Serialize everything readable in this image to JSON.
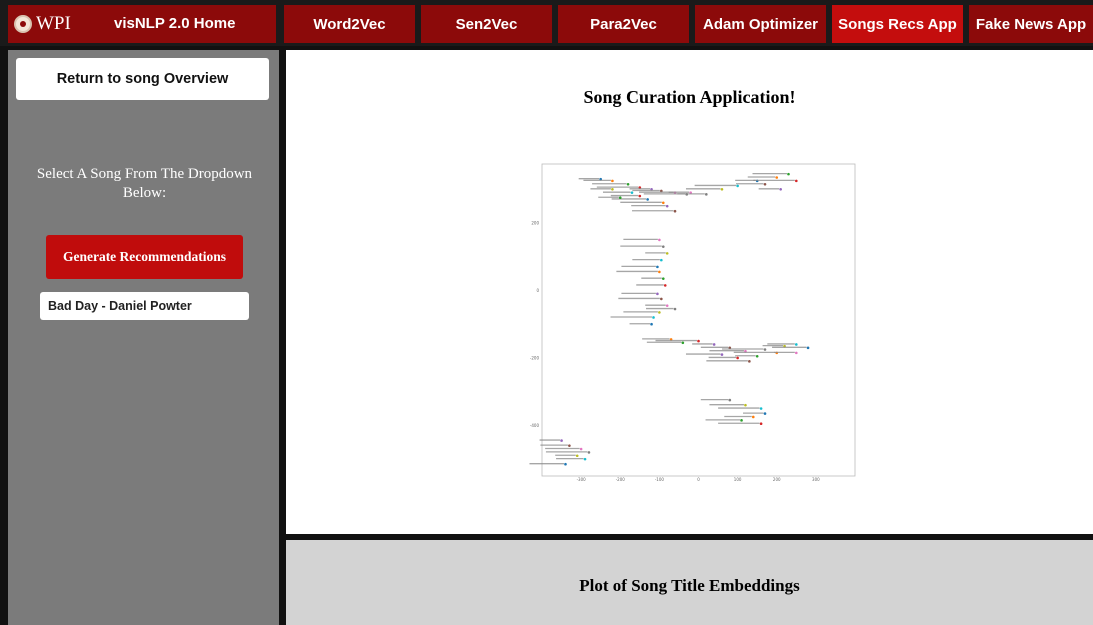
{
  "nav": {
    "logo_text": "WPI",
    "home_label": "visNLP 2.0 Home",
    "tabs": [
      {
        "label": "Word2Vec"
      },
      {
        "label": "Sen2Vec"
      },
      {
        "label": "Para2Vec"
      },
      {
        "label": "Adam Optimizer"
      },
      {
        "label": "Songs Recs App",
        "active": true
      },
      {
        "label": "Fake News App"
      }
    ],
    "colors": {
      "tab": "#8c0a0a",
      "active_tab": "#c40d0d"
    }
  },
  "sidebar": {
    "return_label": "Return to song Overview",
    "select_prompt": "Select A Song From The Dropdown Below:",
    "generate_label": "Generate Recommendations",
    "selected_song": "Bad Day - Daniel Powter"
  },
  "main": {
    "title": "Song Curation Application!"
  },
  "lower": {
    "title": "Plot of Song Title Embeddings"
  },
  "chart_data": {
    "type": "scatter",
    "title": "",
    "xlabel": "",
    "ylabel": "",
    "xlim": [
      -400,
      400
    ],
    "ylim": [
      -550,
      375
    ],
    "x_ticks": [
      -300,
      -200,
      -100,
      0,
      100,
      200,
      300
    ],
    "y_ticks": [
      -400,
      -200,
      0,
      200
    ],
    "grid": false,
    "point_labels_legible": false,
    "points": [
      {
        "x": -250,
        "y": 330
      },
      {
        "x": -220,
        "y": 325
      },
      {
        "x": -180,
        "y": 315
      },
      {
        "x": -150,
        "y": 305
      },
      {
        "x": -120,
        "y": 300
      },
      {
        "x": -95,
        "y": 295
      },
      {
        "x": -60,
        "y": 290
      },
      {
        "x": -30,
        "y": 285
      },
      {
        "x": -220,
        "y": 300
      },
      {
        "x": -170,
        "y": 290
      },
      {
        "x": -130,
        "y": 270
      },
      {
        "x": -90,
        "y": 260
      },
      {
        "x": -200,
        "y": 275
      },
      {
        "x": -150,
        "y": 280
      },
      {
        "x": -80,
        "y": 250
      },
      {
        "x": -60,
        "y": 235
      },
      {
        "x": -20,
        "y": 290
      },
      {
        "x": 20,
        "y": 285
      },
      {
        "x": 60,
        "y": 300
      },
      {
        "x": 100,
        "y": 310
      },
      {
        "x": 150,
        "y": 325
      },
      {
        "x": 200,
        "y": 335
      },
      {
        "x": 230,
        "y": 345
      },
      {
        "x": 250,
        "y": 325
      },
      {
        "x": 210,
        "y": 300
      },
      {
        "x": 170,
        "y": 315
      },
      {
        "x": -100,
        "y": 150
      },
      {
        "x": -90,
        "y": 130
      },
      {
        "x": -80,
        "y": 110
      },
      {
        "x": -95,
        "y": 90
      },
      {
        "x": -105,
        "y": 70
      },
      {
        "x": -100,
        "y": 55
      },
      {
        "x": -90,
        "y": 35
      },
      {
        "x": -85,
        "y": 15
      },
      {
        "x": -105,
        "y": -10
      },
      {
        "x": -95,
        "y": -25
      },
      {
        "x": -80,
        "y": -45
      },
      {
        "x": -60,
        "y": -55
      },
      {
        "x": -100,
        "y": -65
      },
      {
        "x": -115,
        "y": -80
      },
      {
        "x": -120,
        "y": -100
      },
      {
        "x": -70,
        "y": -145
      },
      {
        "x": -40,
        "y": -155
      },
      {
        "x": 0,
        "y": -150
      },
      {
        "x": 40,
        "y": -160
      },
      {
        "x": 80,
        "y": -170
      },
      {
        "x": 120,
        "y": -180
      },
      {
        "x": 170,
        "y": -175
      },
      {
        "x": 220,
        "y": -165
      },
      {
        "x": 250,
        "y": -160
      },
      {
        "x": 280,
        "y": -170
      },
      {
        "x": 200,
        "y": -185
      },
      {
        "x": 150,
        "y": -195
      },
      {
        "x": 100,
        "y": -200
      },
      {
        "x": 60,
        "y": -190
      },
      {
        "x": 130,
        "y": -210
      },
      {
        "x": 250,
        "y": -185
      },
      {
        "x": 80,
        "y": -325
      },
      {
        "x": 120,
        "y": -340
      },
      {
        "x": 160,
        "y": -350
      },
      {
        "x": 170,
        "y": -365
      },
      {
        "x": 140,
        "y": -375
      },
      {
        "x": 110,
        "y": -385
      },
      {
        "x": 160,
        "y": -395
      },
      {
        "x": -350,
        "y": -445
      },
      {
        "x": -330,
        "y": -460
      },
      {
        "x": -300,
        "y": -470
      },
      {
        "x": -280,
        "y": -480
      },
      {
        "x": -310,
        "y": -490
      },
      {
        "x": -290,
        "y": -500
      },
      {
        "x": -340,
        "y": -515
      }
    ]
  }
}
